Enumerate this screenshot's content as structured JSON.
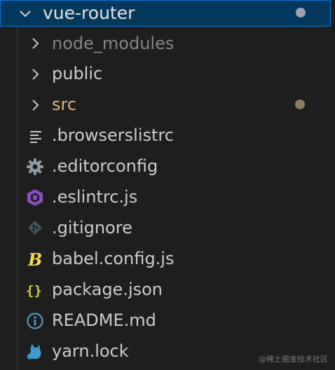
{
  "explorer": {
    "root": {
      "label": "vue-router",
      "expanded": true,
      "status_color": "#9aa3ad"
    },
    "items": [
      {
        "label": "node_modules",
        "type": "folder",
        "expanded": false,
        "color": "#858585"
      },
      {
        "label": "public",
        "type": "folder",
        "expanded": false,
        "color": "#cccccc"
      },
      {
        "label": "src",
        "type": "folder",
        "expanded": false,
        "color": "#d7ba7d",
        "status_color": "#8b7d60"
      },
      {
        "label": ".browserslistrc",
        "type": "file",
        "icon": "lines-icon",
        "color": "#cccccc"
      },
      {
        "label": ".editorconfig",
        "type": "file",
        "icon": "gear-icon",
        "color": "#cccccc"
      },
      {
        "label": ".eslintrc.js",
        "type": "file",
        "icon": "eslint-icon",
        "color": "#cccccc"
      },
      {
        "label": ".gitignore",
        "type": "file",
        "icon": "git-icon",
        "color": "#cccccc"
      },
      {
        "label": "babel.config.js",
        "type": "file",
        "icon": "babel-icon",
        "color": "#cccccc"
      },
      {
        "label": "package.json",
        "type": "file",
        "icon": "json-braces-icon",
        "color": "#cccccc"
      },
      {
        "label": "README.md",
        "type": "file",
        "icon": "info-icon",
        "color": "#cccccc"
      },
      {
        "label": "yarn.lock",
        "type": "file",
        "icon": "yarn-cat-icon",
        "color": "#cccccc"
      }
    ]
  },
  "watermark": "@稀土掘金技术社区",
  "colors": {
    "background": "#1e1e1e",
    "selection": "#04395e",
    "focus_border": "#0078d4"
  }
}
